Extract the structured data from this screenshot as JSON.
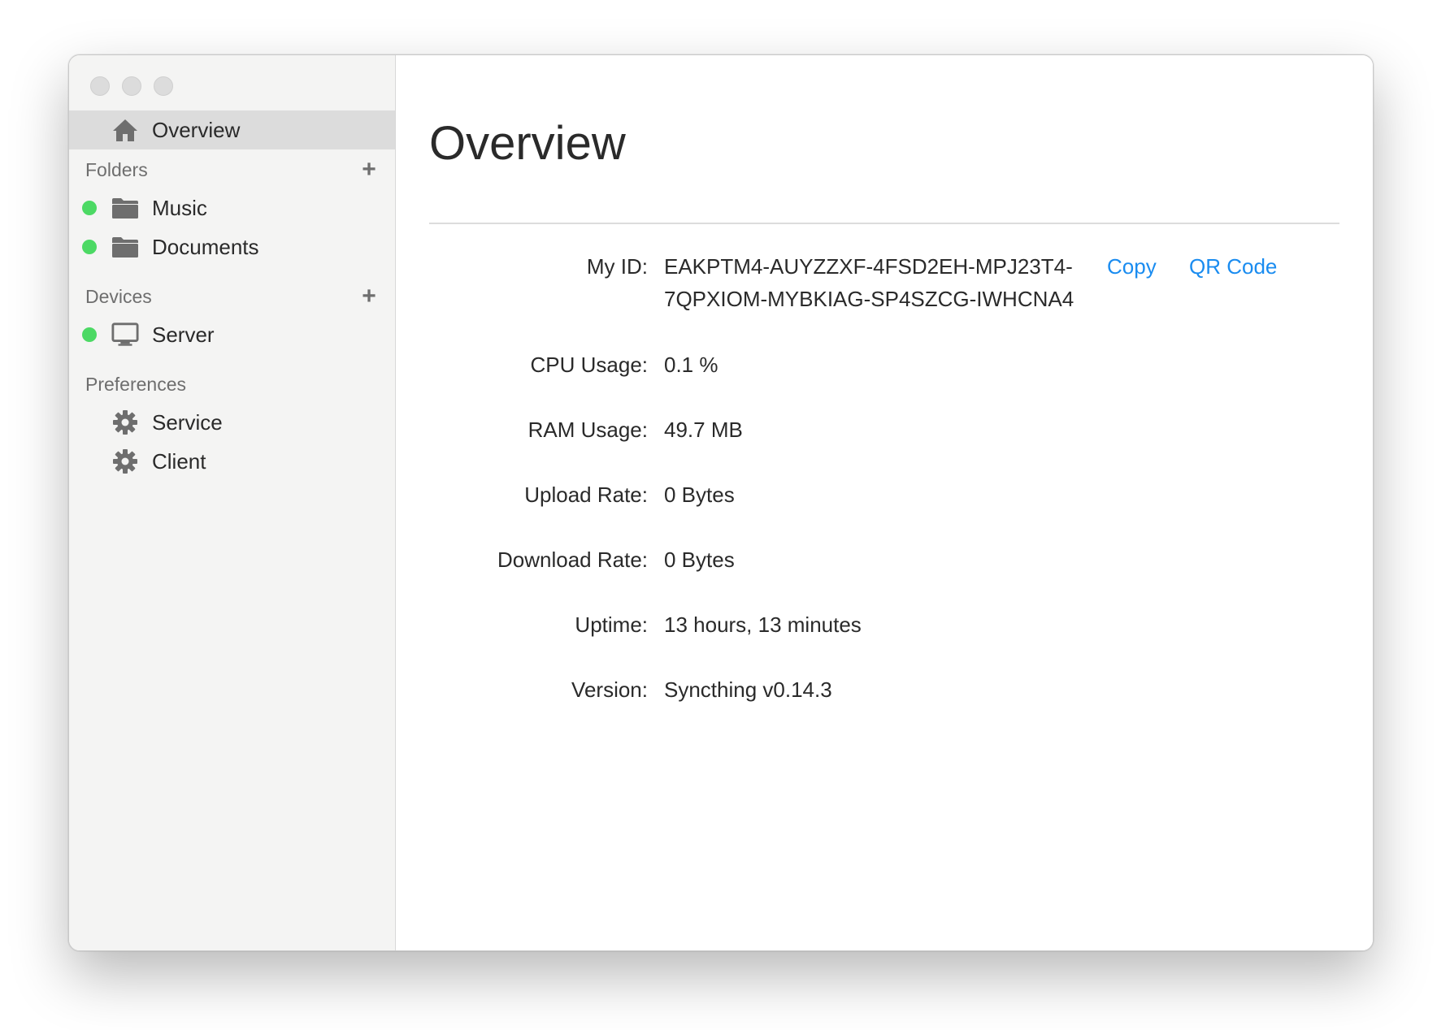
{
  "window": {
    "traffic_lights": [
      "close",
      "minimize",
      "zoom"
    ]
  },
  "sidebar": {
    "overview_label": "Overview",
    "folders": {
      "title": "Folders",
      "items": [
        {
          "label": "Music",
          "status": "online",
          "icon": "folder-icon"
        },
        {
          "label": "Documents",
          "status": "online",
          "icon": "folder-icon"
        }
      ]
    },
    "devices": {
      "title": "Devices",
      "items": [
        {
          "label": "Server",
          "status": "online",
          "icon": "monitor-icon"
        }
      ]
    },
    "preferences": {
      "title": "Preferences",
      "items": [
        {
          "label": "Service",
          "icon": "gear-icon"
        },
        {
          "label": "Client",
          "icon": "gear-icon"
        }
      ]
    },
    "plus_symbol": "+"
  },
  "main": {
    "title": "Overview",
    "my_id": {
      "label": "My ID:",
      "line1": "EAKPTM4-AUYZZXF-4FSD2EH-MPJ23T4-",
      "line2": "7QPXIOM-MYBKIAG-SP4SZCG-IWHCNA4",
      "copy_label": "Copy",
      "qr_label": "QR Code"
    },
    "stats": [
      {
        "label": "CPU Usage:",
        "value": "0.1 %"
      },
      {
        "label": "RAM Usage:",
        "value": "49.7 MB"
      },
      {
        "label": "Upload Rate:",
        "value": "0 Bytes"
      },
      {
        "label": "Download Rate:",
        "value": "0 Bytes"
      },
      {
        "label": "Uptime:",
        "value": "13 hours, 13 minutes"
      },
      {
        "label": "Version:",
        "value": "Syncthing v0.14.3"
      }
    ]
  },
  "colors": {
    "accent": "#1a8cf0",
    "status_online": "#4cd964",
    "sidebar_bg": "#f4f4f3",
    "selected_bg": "#dcdcdc"
  }
}
